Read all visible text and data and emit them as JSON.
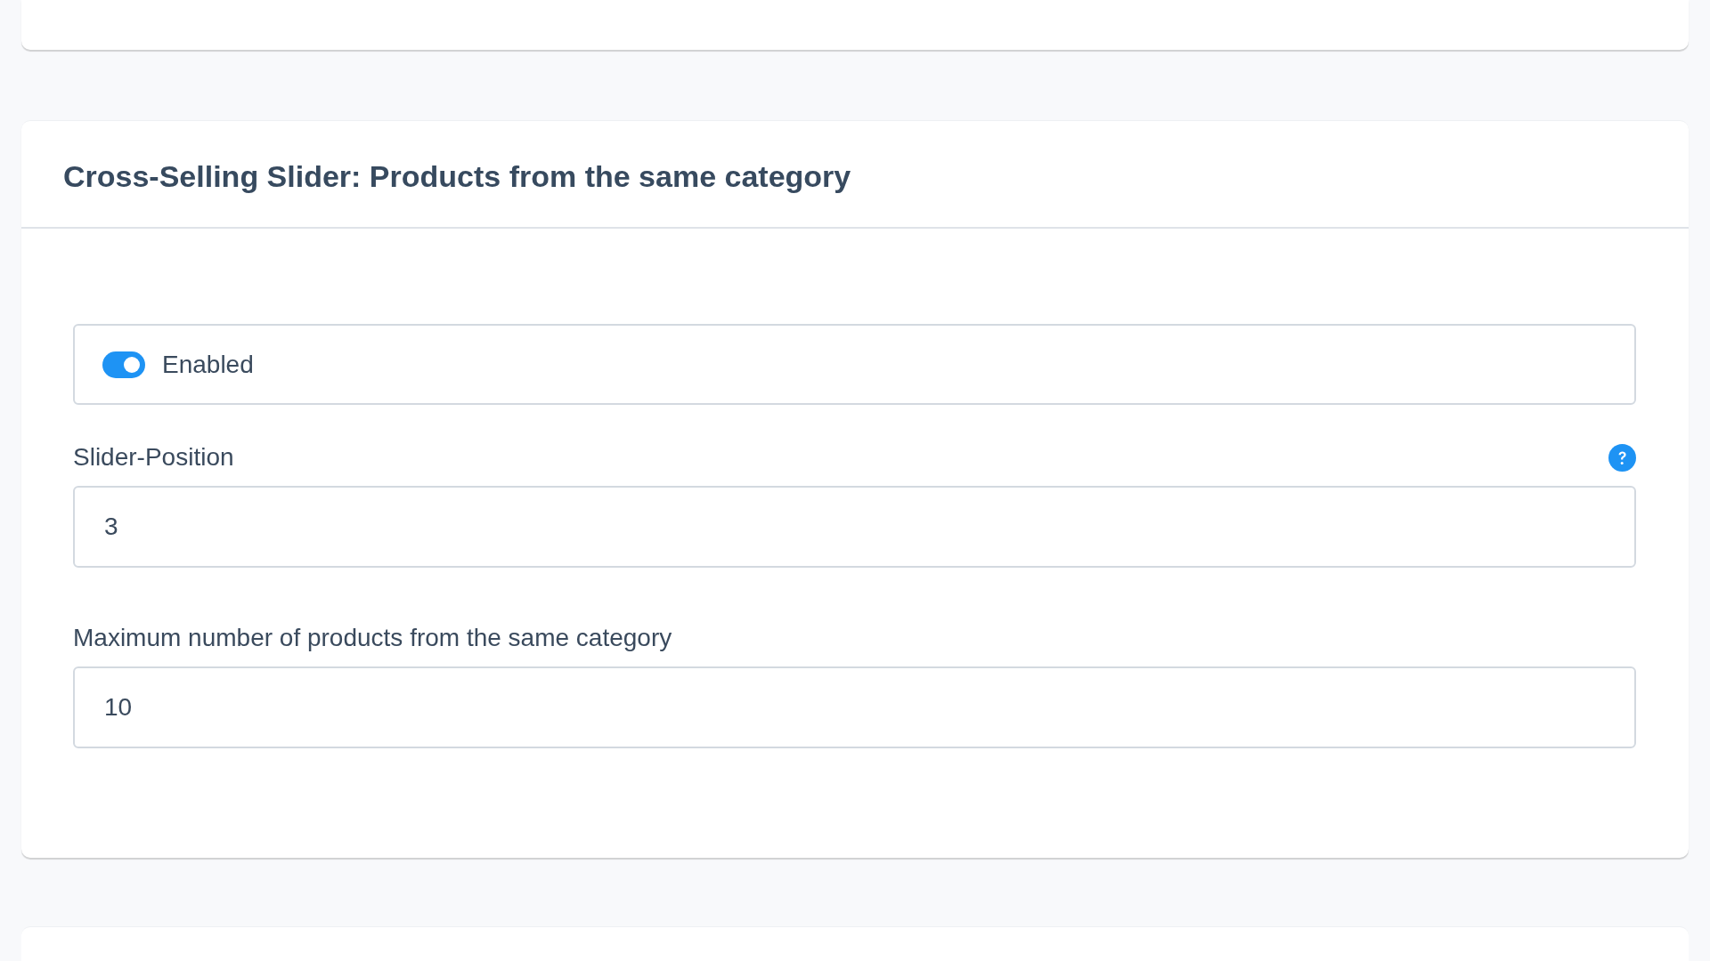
{
  "section": {
    "title": "Cross-Selling Slider: Products from the same category",
    "toggle": {
      "label": "Enabled",
      "on": true
    },
    "fields": [
      {
        "label": "Slider-Position",
        "value": "3",
        "help": true
      },
      {
        "label": "Maximum number of products from the same category",
        "value": "10",
        "help": false
      }
    ]
  }
}
